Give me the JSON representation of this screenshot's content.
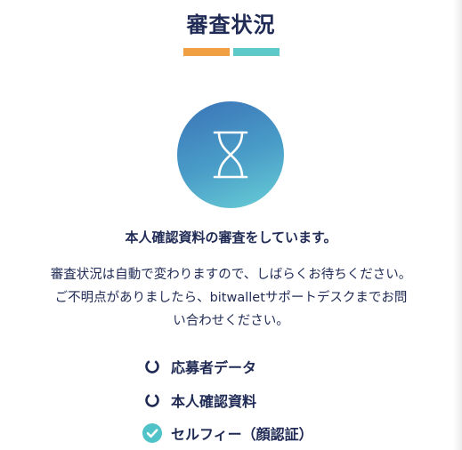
{
  "page": {
    "title": "審査状況"
  },
  "colors": {
    "accent_orange": "#f0a043",
    "accent_teal": "#5ec9c9",
    "text_navy": "#1f2a55",
    "check_teal": "#4fc3c7"
  },
  "status": {
    "icon": "hourglass-icon",
    "heading": "本人確認資料の審査をしています。",
    "description_lines": [
      "審査状況は自動で変わりますので、しばらくお待ちください。",
      "ご不明点がありましたら、bitwalletサポートデスクまでお問",
      "い合わせください。"
    ]
  },
  "steps": [
    {
      "label": "応募者データ",
      "state": "pending",
      "icon": "circle-pending-icon"
    },
    {
      "label": "本人確認資料",
      "state": "pending",
      "icon": "circle-pending-icon"
    },
    {
      "label": "セルフィー（顔認証）",
      "state": "complete",
      "icon": "check-circle-icon"
    }
  ]
}
